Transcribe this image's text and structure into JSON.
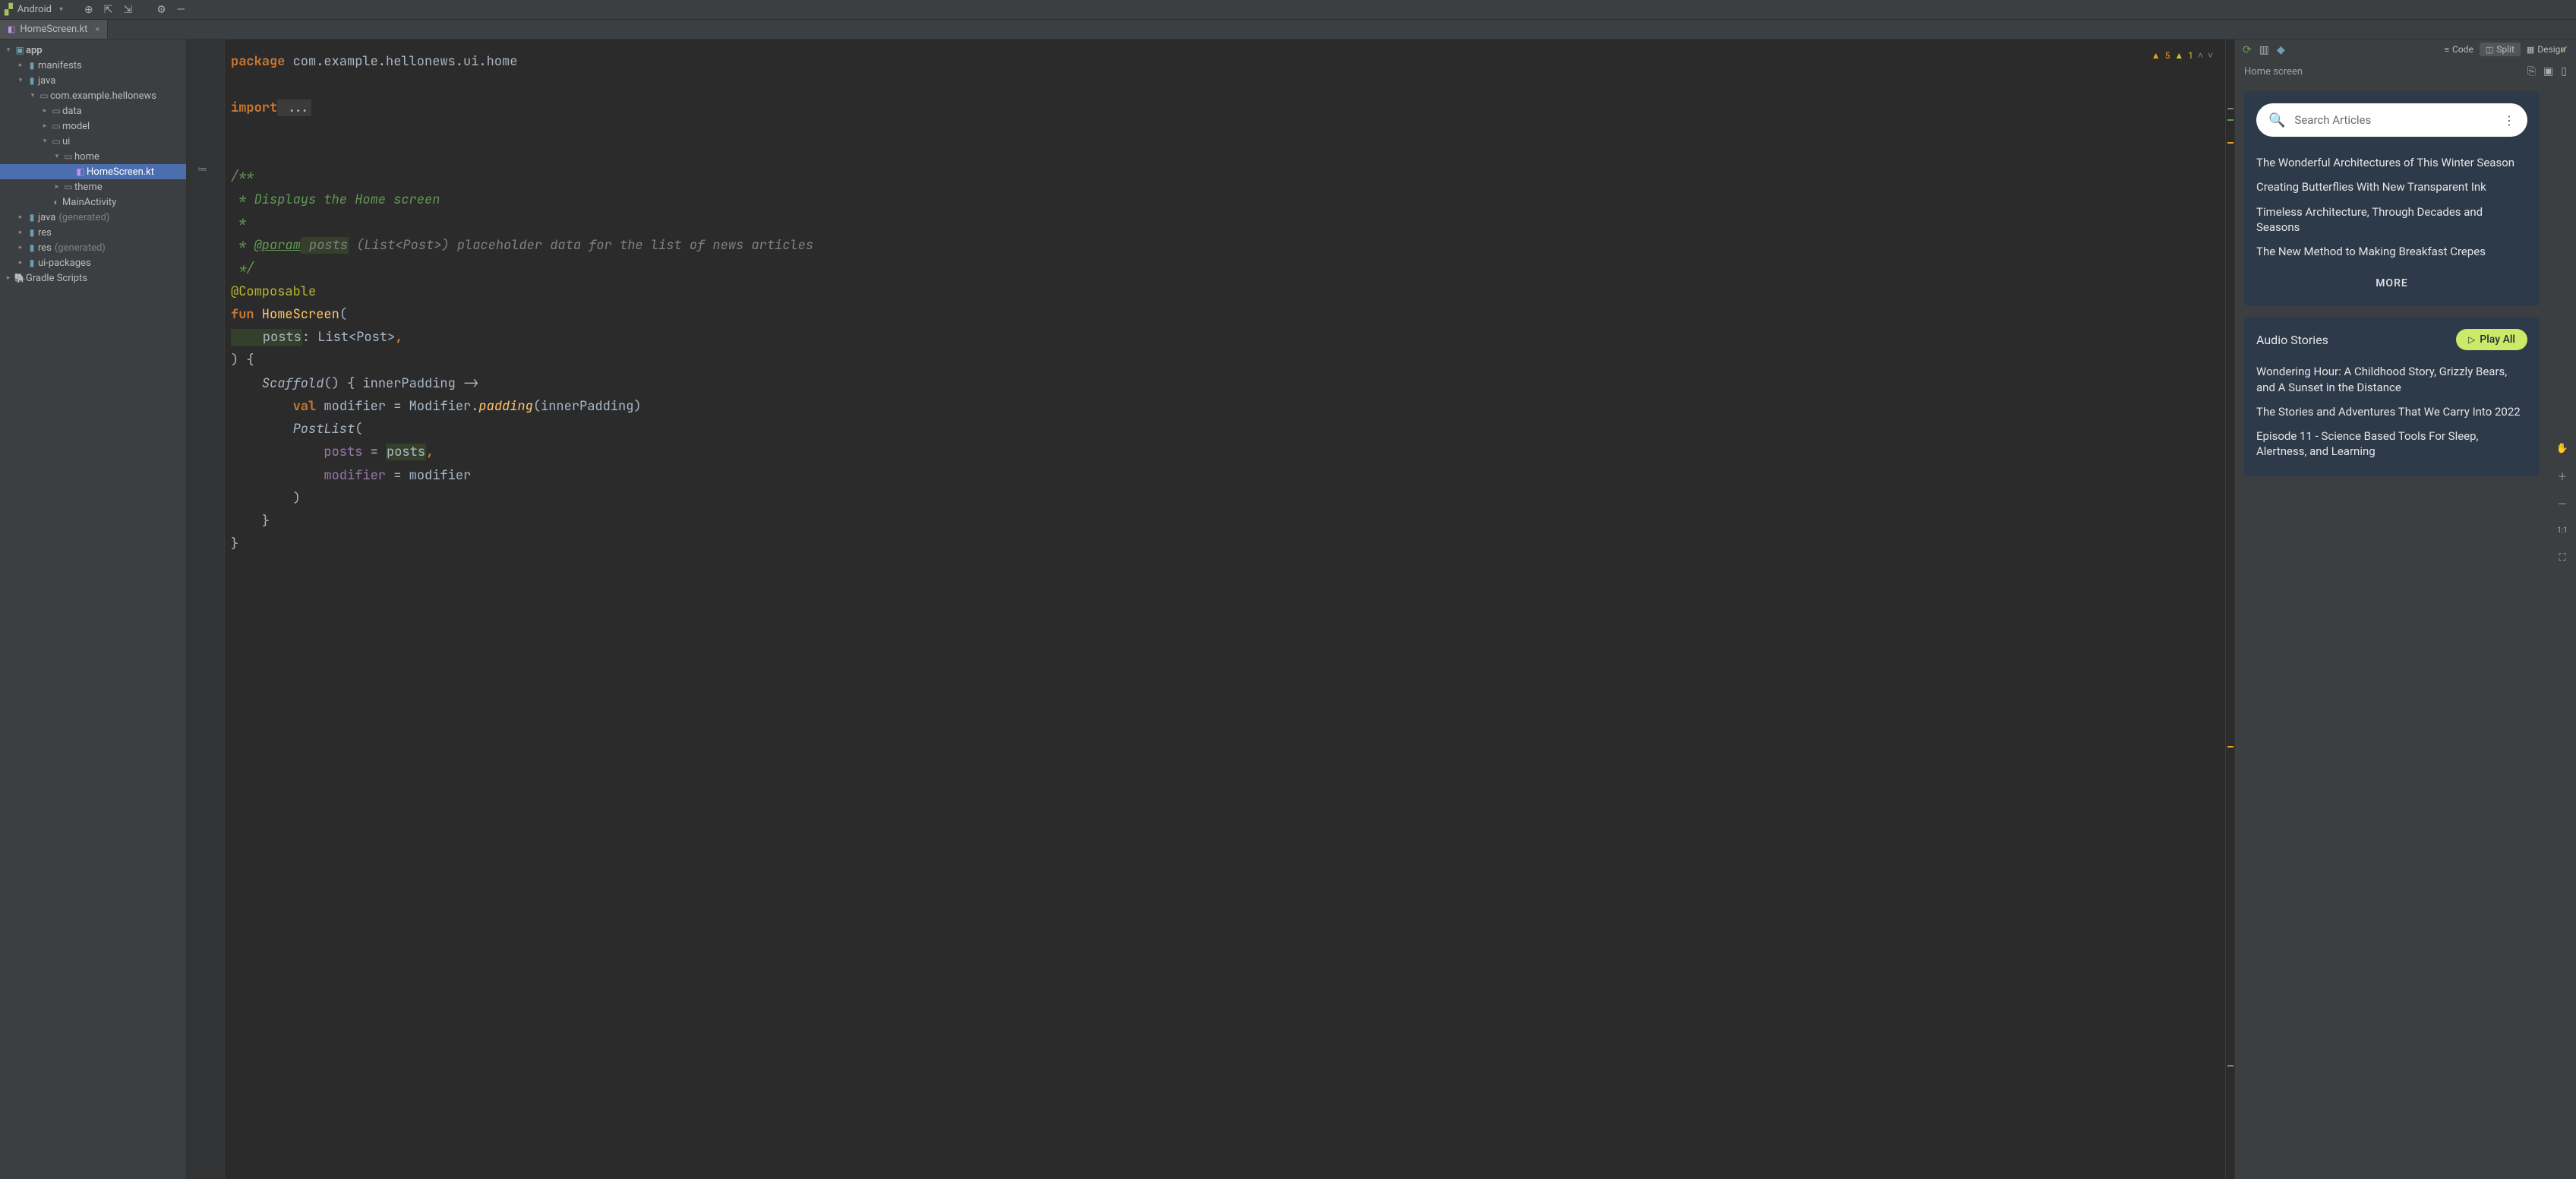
{
  "menubar": {
    "project_label": "Android"
  },
  "tab": {
    "filename": "HomeScreen.kt"
  },
  "view_modes": {
    "code": "Code",
    "split": "Split",
    "design": "Design"
  },
  "tree": {
    "app": "app",
    "manifests": "manifests",
    "java": "java",
    "package": "com.example.hellonews",
    "data": "data",
    "model": "model",
    "ui": "ui",
    "home": "home",
    "homescreen": "HomeScreen.kt",
    "theme": "theme",
    "mainactivity": "MainActivity",
    "java_gen": "java",
    "java_gen_note": "(generated)",
    "res": "res",
    "res_gen": "res",
    "res_gen_note": "(generated)",
    "uipackages": "ui-packages",
    "gradle": "Gradle Scripts"
  },
  "inspection": {
    "warn_count": "5",
    "weak_count": "1"
  },
  "code": {
    "l1a": "package",
    "l1b": " com.example.hellonews.ui.home",
    "l2a": "import",
    "l2b": " ...",
    "l3a": "/**",
    "l3b": " * Displays the Home screen",
    "l3c": " *",
    "l3d": " * ",
    "l3d_tag": "@param",
    "l3d_name": " posts",
    "l3d_rest": " (List<Post>) placeholder data for the list of news articles",
    "l3e": " */",
    "l4": "@Composable",
    "l5a": "fun",
    "l5b": " HomeScreen",
    "l5c": "(",
    "l6a": "    posts",
    "l6b": ": List<Post>",
    "l6c": ",",
    "l7": ") {",
    "l8a": "Scaffold",
    "l8b": "()",
    "l8c": " { innerPadding ->",
    "l9a": "val",
    "l9b": " modifier = Modifier.",
    "l9c": "padding",
    "l9d": "(innerPadding)",
    "l10a": "PostList",
    "l10b": "(",
    "l11a": "posts",
    "l11b": " = ",
    "l11c": "posts",
    "l11d": ",",
    "l12a": "modifier",
    "l12b": " = modifier",
    "l13": ")",
    "l14": "}",
    "l15": "}"
  },
  "preview": {
    "header_title": "Home screen",
    "search_placeholder": "Search Articles",
    "articles": {
      "a1": "The Wonderful Architectures of This Winter Season",
      "a2": "Creating Butterflies With New Transparent Ink",
      "a3": "Timeless Architecture, Through Decades and Seasons",
      "a4": "The New Method to Making Breakfast Crepes"
    },
    "more": "MORE",
    "audio_title": "Audio Stories",
    "play_all": "Play All",
    "audio_stories": {
      "s1": "Wondering Hour: A Childhood Story, Grizzly Bears, and A Sunset in the Distance",
      "s2": "The Stories and Adventures That We Carry Into 2022",
      "s3": "Episode 11 - Science Based Tools For Sleep, Alertness, and Learning"
    },
    "zoom_11": "1:1"
  }
}
